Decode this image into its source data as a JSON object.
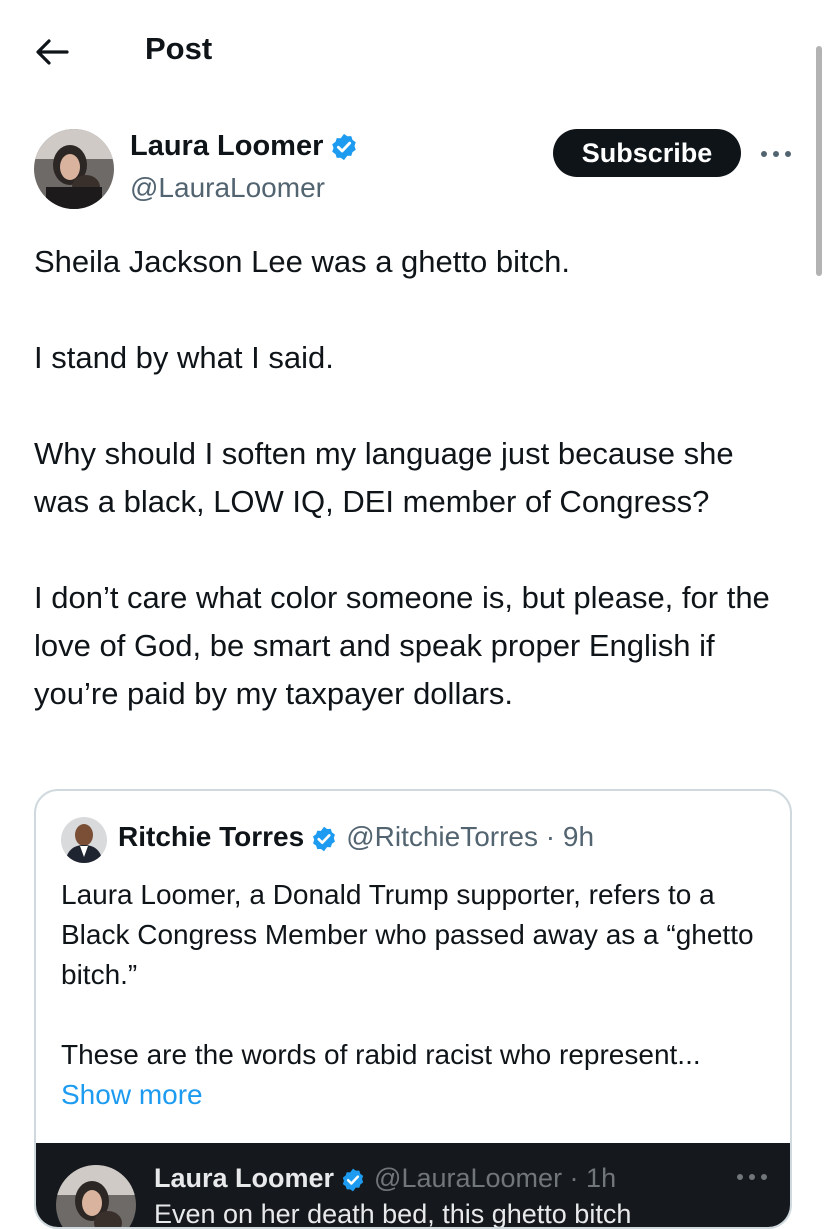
{
  "header": {
    "title": "Post"
  },
  "post": {
    "author_name": "Laura Loomer",
    "author_handle": "@LauraLoomer",
    "subscribe_label": "Subscribe",
    "paragraphs": [
      "Sheila Jackson Lee was a ghetto bitch.",
      "I stand by what I said.",
      "Why should I soften my language just because she was a black, LOW IQ, DEI member of Congress?",
      "I don’t care what color someone is, but please, for the love of God, be smart and speak proper English if you’re paid by my taxpayer dollars."
    ]
  },
  "quote": {
    "author_name": "Ritchie Torres",
    "author_handle": "@RitchieTorres · 9h",
    "paragraphs": [
      "Laura Loomer, a Donald Trump supporter, refers to a Black Congress Member who passed away as a “ghetto bitch.”",
      "These are the words of rabid racist who represent..."
    ],
    "show_more_label": "Show more",
    "media": {
      "author_name": "Laura Loomer",
      "author_handle": "@LauraLoomer · 1h",
      "text": "Even on her death bed, this ghetto bitch"
    }
  },
  "colors": {
    "accent": "#1d9bf0",
    "text": "#0f1419",
    "muted": "#536471",
    "border": "#cfd9de",
    "dark_bg": "#15181c"
  },
  "icons": [
    "back-arrow-icon",
    "verified-badge-icon",
    "more-options-icon"
  ]
}
